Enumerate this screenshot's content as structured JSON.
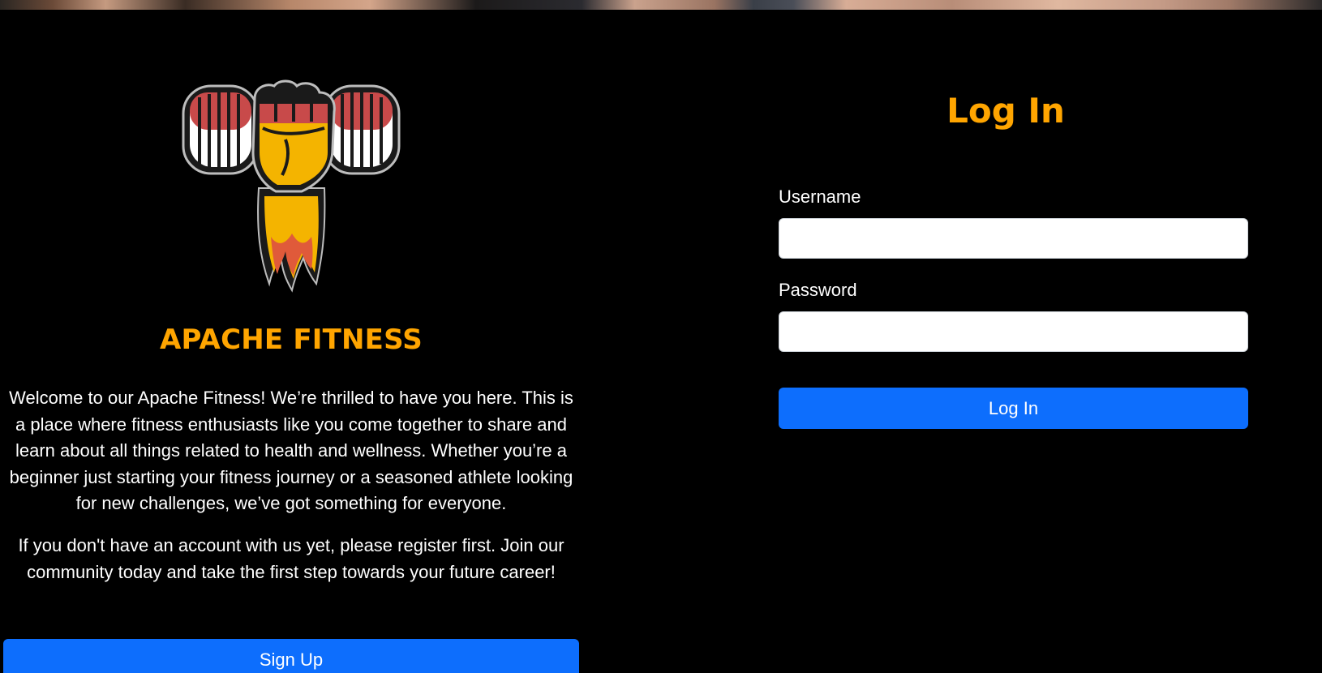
{
  "brand": {
    "name": "APACHE FITNESS",
    "accent_color": "#ffa500",
    "logo_icon": "flaming-fist-dumbbell-icon"
  },
  "intro": {
    "welcome_text": "Welcome to our Apache Fitness! We’re thrilled to have you here. This is a place where fitness enthusiasts like you come together to share and learn about all things related to health and wellness. Whether you’re a beginner just starting your fitness journey or a seasoned athlete looking for new challenges, we’ve got something for everyone.",
    "register_note": "If you don't have an account with us yet, please register first. Join our community today and take the first step towards your future career!",
    "signup_label": "Sign Up"
  },
  "login": {
    "title": "Log In",
    "username_label": "Username",
    "username_value": "",
    "password_label": "Password",
    "password_value": "",
    "submit_label": "Log In",
    "button_color": "#0d6efd"
  }
}
